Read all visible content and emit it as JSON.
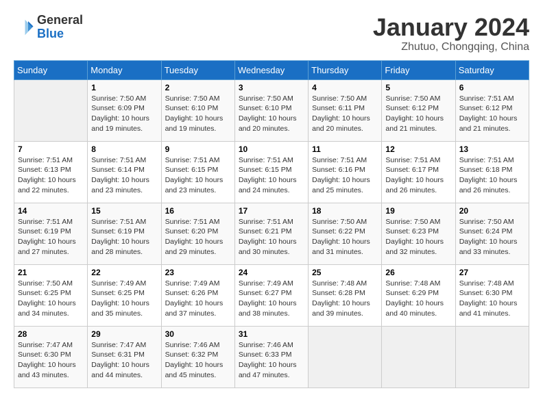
{
  "header": {
    "logo_text_general": "General",
    "logo_text_blue": "Blue",
    "month_title": "January 2024",
    "location": "Zhutuo, Chongqing, China"
  },
  "calendar": {
    "days_of_week": [
      "Sunday",
      "Monday",
      "Tuesday",
      "Wednesday",
      "Thursday",
      "Friday",
      "Saturday"
    ],
    "weeks": [
      [
        {
          "day": "",
          "info": ""
        },
        {
          "day": "1",
          "info": "Sunrise: 7:50 AM\nSunset: 6:09 PM\nDaylight: 10 hours\nand 19 minutes."
        },
        {
          "day": "2",
          "info": "Sunrise: 7:50 AM\nSunset: 6:10 PM\nDaylight: 10 hours\nand 19 minutes."
        },
        {
          "day": "3",
          "info": "Sunrise: 7:50 AM\nSunset: 6:10 PM\nDaylight: 10 hours\nand 20 minutes."
        },
        {
          "day": "4",
          "info": "Sunrise: 7:50 AM\nSunset: 6:11 PM\nDaylight: 10 hours\nand 20 minutes."
        },
        {
          "day": "5",
          "info": "Sunrise: 7:50 AM\nSunset: 6:12 PM\nDaylight: 10 hours\nand 21 minutes."
        },
        {
          "day": "6",
          "info": "Sunrise: 7:51 AM\nSunset: 6:12 PM\nDaylight: 10 hours\nand 21 minutes."
        }
      ],
      [
        {
          "day": "7",
          "info": "Sunrise: 7:51 AM\nSunset: 6:13 PM\nDaylight: 10 hours\nand 22 minutes."
        },
        {
          "day": "8",
          "info": "Sunrise: 7:51 AM\nSunset: 6:14 PM\nDaylight: 10 hours\nand 23 minutes."
        },
        {
          "day": "9",
          "info": "Sunrise: 7:51 AM\nSunset: 6:15 PM\nDaylight: 10 hours\nand 23 minutes."
        },
        {
          "day": "10",
          "info": "Sunrise: 7:51 AM\nSunset: 6:15 PM\nDaylight: 10 hours\nand 24 minutes."
        },
        {
          "day": "11",
          "info": "Sunrise: 7:51 AM\nSunset: 6:16 PM\nDaylight: 10 hours\nand 25 minutes."
        },
        {
          "day": "12",
          "info": "Sunrise: 7:51 AM\nSunset: 6:17 PM\nDaylight: 10 hours\nand 26 minutes."
        },
        {
          "day": "13",
          "info": "Sunrise: 7:51 AM\nSunset: 6:18 PM\nDaylight: 10 hours\nand 26 minutes."
        }
      ],
      [
        {
          "day": "14",
          "info": "Sunrise: 7:51 AM\nSunset: 6:19 PM\nDaylight: 10 hours\nand 27 minutes."
        },
        {
          "day": "15",
          "info": "Sunrise: 7:51 AM\nSunset: 6:19 PM\nDaylight: 10 hours\nand 28 minutes."
        },
        {
          "day": "16",
          "info": "Sunrise: 7:51 AM\nSunset: 6:20 PM\nDaylight: 10 hours\nand 29 minutes."
        },
        {
          "day": "17",
          "info": "Sunrise: 7:51 AM\nSunset: 6:21 PM\nDaylight: 10 hours\nand 30 minutes."
        },
        {
          "day": "18",
          "info": "Sunrise: 7:50 AM\nSunset: 6:22 PM\nDaylight: 10 hours\nand 31 minutes."
        },
        {
          "day": "19",
          "info": "Sunrise: 7:50 AM\nSunset: 6:23 PM\nDaylight: 10 hours\nand 32 minutes."
        },
        {
          "day": "20",
          "info": "Sunrise: 7:50 AM\nSunset: 6:24 PM\nDaylight: 10 hours\nand 33 minutes."
        }
      ],
      [
        {
          "day": "21",
          "info": "Sunrise: 7:50 AM\nSunset: 6:25 PM\nDaylight: 10 hours\nand 34 minutes."
        },
        {
          "day": "22",
          "info": "Sunrise: 7:49 AM\nSunset: 6:25 PM\nDaylight: 10 hours\nand 35 minutes."
        },
        {
          "day": "23",
          "info": "Sunrise: 7:49 AM\nSunset: 6:26 PM\nDaylight: 10 hours\nand 37 minutes."
        },
        {
          "day": "24",
          "info": "Sunrise: 7:49 AM\nSunset: 6:27 PM\nDaylight: 10 hours\nand 38 minutes."
        },
        {
          "day": "25",
          "info": "Sunrise: 7:48 AM\nSunset: 6:28 PM\nDaylight: 10 hours\nand 39 minutes."
        },
        {
          "day": "26",
          "info": "Sunrise: 7:48 AM\nSunset: 6:29 PM\nDaylight: 10 hours\nand 40 minutes."
        },
        {
          "day": "27",
          "info": "Sunrise: 7:48 AM\nSunset: 6:30 PM\nDaylight: 10 hours\nand 41 minutes."
        }
      ],
      [
        {
          "day": "28",
          "info": "Sunrise: 7:47 AM\nSunset: 6:30 PM\nDaylight: 10 hours\nand 43 minutes."
        },
        {
          "day": "29",
          "info": "Sunrise: 7:47 AM\nSunset: 6:31 PM\nDaylight: 10 hours\nand 44 minutes."
        },
        {
          "day": "30",
          "info": "Sunrise: 7:46 AM\nSunset: 6:32 PM\nDaylight: 10 hours\nand 45 minutes."
        },
        {
          "day": "31",
          "info": "Sunrise: 7:46 AM\nSunset: 6:33 PM\nDaylight: 10 hours\nand 47 minutes."
        },
        {
          "day": "",
          "info": ""
        },
        {
          "day": "",
          "info": ""
        },
        {
          "day": "",
          "info": ""
        }
      ]
    ]
  }
}
